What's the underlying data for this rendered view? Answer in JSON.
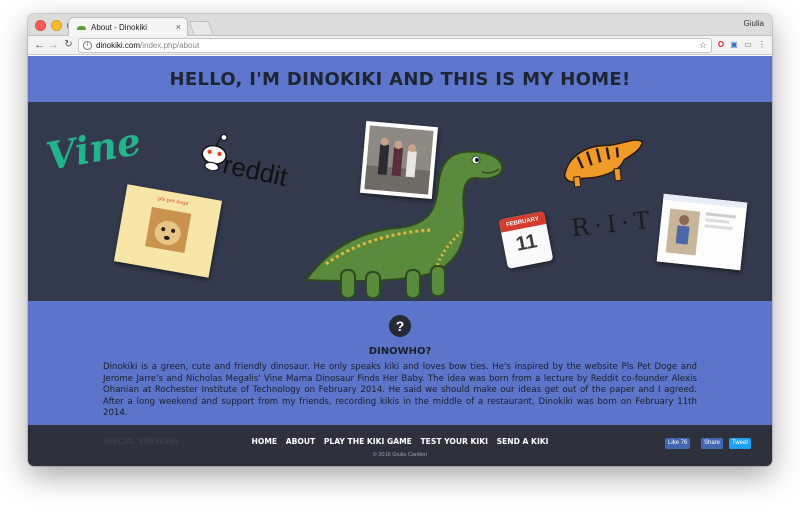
{
  "browser": {
    "tab_title": "About - Dinokiki",
    "tab_close": "×",
    "user_name": "Giulia",
    "url_domain": "dinokiki.com",
    "url_path": "/index.php/about"
  },
  "page": {
    "header_title": "HELLO, I'M DINOKIKI AND THIS IS MY HOME!",
    "banner": {
      "vine_logo_text": "Vine",
      "reddit_logo_text": "reddit",
      "pls_pet_doge_title": "pls pet doge",
      "rit_logo_text": "R·I·T",
      "calendar_month": "FEBRUARY",
      "calendar_day": "11"
    },
    "about": {
      "icon_text": "?",
      "heading": "DINOWHO?",
      "body": "Dinokiki is a green, cute and friendly dinosaur. He only speaks kiki and loves bow ties. He's inspired by the website Pls Pet Doge and Jerome Jarre's and Nicholas Megalis' Vine Mama Dinosaur Finds Her Baby. The idea was born from a lecture by Reddit co-founder Alexis Ohanian at Rochester Institute of Technology on February 2014. He said we should make our ideas get out of the paper and I agreed. After a long weekend and support from my friends, recording kikis in the middle of a restaurant, Dinokiki was born on February 11th 2014."
    },
    "footer": {
      "special_versions": "SPECIAL VERSIONS",
      "nav": [
        "HOME",
        "ABOUT",
        "PLAY THE KIKI GAME",
        "TEST YOUR KIKI",
        "SEND A KIKI"
      ],
      "copyright": "© 2016 Giulia Cardieri",
      "like_label": "Like 76",
      "share_label": "Share",
      "tweet_label": "Tweet"
    }
  },
  "colors": {
    "page_blue": "#5c74c9",
    "banner_dark": "#343a4d",
    "dino_green": "#5a8a3c",
    "vine_green": "#22b48a"
  }
}
